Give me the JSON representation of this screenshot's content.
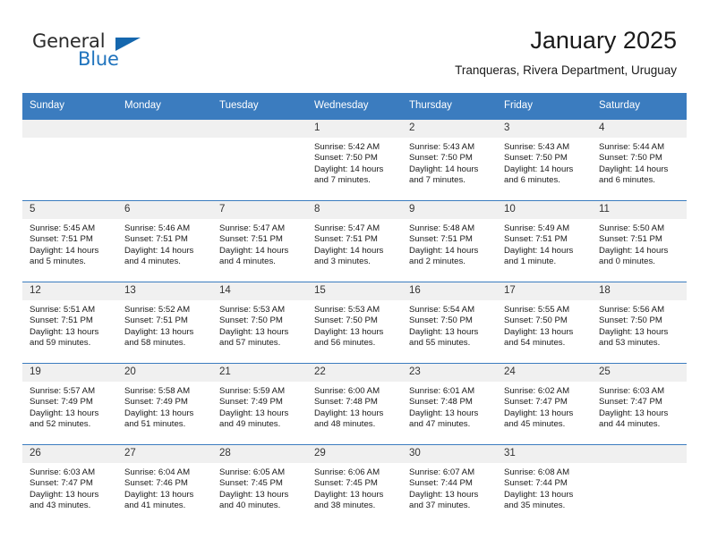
{
  "brand": {
    "name_dark": "General",
    "name_blue": "Blue",
    "triangle_color": "#1567ae",
    "blue_color": "#1f73bd"
  },
  "header": {
    "title": "January 2025",
    "subtitle": "Tranqueras, Rivera Department, Uruguay"
  },
  "theme": {
    "header_bg": "#3b7cbf",
    "header_text": "#ffffff",
    "daynum_bg": "#f0f0f0",
    "row_line": "#3b7cbf"
  },
  "labels": {
    "sunrise": "Sunrise:",
    "sunset": "Sunset:",
    "daylight": "Daylight:"
  },
  "weekdays": [
    "Sunday",
    "Monday",
    "Tuesday",
    "Wednesday",
    "Thursday",
    "Friday",
    "Saturday"
  ],
  "weeks": [
    [
      {
        "day": "",
        "empty": true
      },
      {
        "day": "",
        "empty": true
      },
      {
        "day": "",
        "empty": true
      },
      {
        "day": "1",
        "sunrise": "Sunrise: 5:42 AM",
        "sunset": "Sunset: 7:50 PM",
        "daylight": "Daylight: 14 hours and 7 minutes."
      },
      {
        "day": "2",
        "sunrise": "Sunrise: 5:43 AM",
        "sunset": "Sunset: 7:50 PM",
        "daylight": "Daylight: 14 hours and 7 minutes."
      },
      {
        "day": "3",
        "sunrise": "Sunrise: 5:43 AM",
        "sunset": "Sunset: 7:50 PM",
        "daylight": "Daylight: 14 hours and 6 minutes."
      },
      {
        "day": "4",
        "sunrise": "Sunrise: 5:44 AM",
        "sunset": "Sunset: 7:50 PM",
        "daylight": "Daylight: 14 hours and 6 minutes."
      }
    ],
    [
      {
        "day": "5",
        "sunrise": "Sunrise: 5:45 AM",
        "sunset": "Sunset: 7:51 PM",
        "daylight": "Daylight: 14 hours and 5 minutes."
      },
      {
        "day": "6",
        "sunrise": "Sunrise: 5:46 AM",
        "sunset": "Sunset: 7:51 PM",
        "daylight": "Daylight: 14 hours and 4 minutes."
      },
      {
        "day": "7",
        "sunrise": "Sunrise: 5:47 AM",
        "sunset": "Sunset: 7:51 PM",
        "daylight": "Daylight: 14 hours and 4 minutes."
      },
      {
        "day": "8",
        "sunrise": "Sunrise: 5:47 AM",
        "sunset": "Sunset: 7:51 PM",
        "daylight": "Daylight: 14 hours and 3 minutes."
      },
      {
        "day": "9",
        "sunrise": "Sunrise: 5:48 AM",
        "sunset": "Sunset: 7:51 PM",
        "daylight": "Daylight: 14 hours and 2 minutes."
      },
      {
        "day": "10",
        "sunrise": "Sunrise: 5:49 AM",
        "sunset": "Sunset: 7:51 PM",
        "daylight": "Daylight: 14 hours and 1 minute."
      },
      {
        "day": "11",
        "sunrise": "Sunrise: 5:50 AM",
        "sunset": "Sunset: 7:51 PM",
        "daylight": "Daylight: 14 hours and 0 minutes."
      }
    ],
    [
      {
        "day": "12",
        "sunrise": "Sunrise: 5:51 AM",
        "sunset": "Sunset: 7:51 PM",
        "daylight": "Daylight: 13 hours and 59 minutes."
      },
      {
        "day": "13",
        "sunrise": "Sunrise: 5:52 AM",
        "sunset": "Sunset: 7:51 PM",
        "daylight": "Daylight: 13 hours and 58 minutes."
      },
      {
        "day": "14",
        "sunrise": "Sunrise: 5:53 AM",
        "sunset": "Sunset: 7:50 PM",
        "daylight": "Daylight: 13 hours and 57 minutes."
      },
      {
        "day": "15",
        "sunrise": "Sunrise: 5:53 AM",
        "sunset": "Sunset: 7:50 PM",
        "daylight": "Daylight: 13 hours and 56 minutes."
      },
      {
        "day": "16",
        "sunrise": "Sunrise: 5:54 AM",
        "sunset": "Sunset: 7:50 PM",
        "daylight": "Daylight: 13 hours and 55 minutes."
      },
      {
        "day": "17",
        "sunrise": "Sunrise: 5:55 AM",
        "sunset": "Sunset: 7:50 PM",
        "daylight": "Daylight: 13 hours and 54 minutes."
      },
      {
        "day": "18",
        "sunrise": "Sunrise: 5:56 AM",
        "sunset": "Sunset: 7:50 PM",
        "daylight": "Daylight: 13 hours and 53 minutes."
      }
    ],
    [
      {
        "day": "19",
        "sunrise": "Sunrise: 5:57 AM",
        "sunset": "Sunset: 7:49 PM",
        "daylight": "Daylight: 13 hours and 52 minutes."
      },
      {
        "day": "20",
        "sunrise": "Sunrise: 5:58 AM",
        "sunset": "Sunset: 7:49 PM",
        "daylight": "Daylight: 13 hours and 51 minutes."
      },
      {
        "day": "21",
        "sunrise": "Sunrise: 5:59 AM",
        "sunset": "Sunset: 7:49 PM",
        "daylight": "Daylight: 13 hours and 49 minutes."
      },
      {
        "day": "22",
        "sunrise": "Sunrise: 6:00 AM",
        "sunset": "Sunset: 7:48 PM",
        "daylight": "Daylight: 13 hours and 48 minutes."
      },
      {
        "day": "23",
        "sunrise": "Sunrise: 6:01 AM",
        "sunset": "Sunset: 7:48 PM",
        "daylight": "Daylight: 13 hours and 47 minutes."
      },
      {
        "day": "24",
        "sunrise": "Sunrise: 6:02 AM",
        "sunset": "Sunset: 7:47 PM",
        "daylight": "Daylight: 13 hours and 45 minutes."
      },
      {
        "day": "25",
        "sunrise": "Sunrise: 6:03 AM",
        "sunset": "Sunset: 7:47 PM",
        "daylight": "Daylight: 13 hours and 44 minutes."
      }
    ],
    [
      {
        "day": "26",
        "sunrise": "Sunrise: 6:03 AM",
        "sunset": "Sunset: 7:47 PM",
        "daylight": "Daylight: 13 hours and 43 minutes."
      },
      {
        "day": "27",
        "sunrise": "Sunrise: 6:04 AM",
        "sunset": "Sunset: 7:46 PM",
        "daylight": "Daylight: 13 hours and 41 minutes."
      },
      {
        "day": "28",
        "sunrise": "Sunrise: 6:05 AM",
        "sunset": "Sunset: 7:45 PM",
        "daylight": "Daylight: 13 hours and 40 minutes."
      },
      {
        "day": "29",
        "sunrise": "Sunrise: 6:06 AM",
        "sunset": "Sunset: 7:45 PM",
        "daylight": "Daylight: 13 hours and 38 minutes."
      },
      {
        "day": "30",
        "sunrise": "Sunrise: 6:07 AM",
        "sunset": "Sunset: 7:44 PM",
        "daylight": "Daylight: 13 hours and 37 minutes."
      },
      {
        "day": "31",
        "sunrise": "Sunrise: 6:08 AM",
        "sunset": "Sunset: 7:44 PM",
        "daylight": "Daylight: 13 hours and 35 minutes."
      },
      {
        "day": "",
        "empty": true
      }
    ]
  ]
}
